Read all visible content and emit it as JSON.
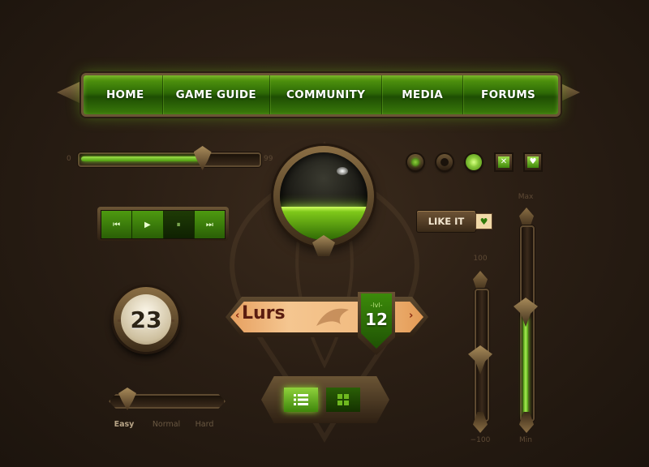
{
  "nav": {
    "items": [
      "HOME",
      "GAME GUIDE",
      "COMMUNITY",
      "MEDIA",
      "FORUMS"
    ]
  },
  "volume_slider": {
    "min_label": "0",
    "max_label": "99",
    "value_fraction": 0.7
  },
  "media_controls": {
    "prev_glyph": "⏮",
    "play_glyph": "▶",
    "pause_glyph": "⏸",
    "next_glyph": "⏭",
    "active": "pause"
  },
  "orb": {
    "fill_fraction": 0.38
  },
  "toggles": {
    "ring_states": [
      "on",
      "off",
      "lit"
    ],
    "close_glyph": "✕",
    "heart_glyph": "♥"
  },
  "like": {
    "label": "LIKE IT",
    "heart_glyph": "♥"
  },
  "counter": {
    "value": "23"
  },
  "character": {
    "name": "Lurs",
    "level_tag": "-lvl-",
    "level": "12",
    "prev_glyph": "‹",
    "next_glyph": "›"
  },
  "difficulty": {
    "options": [
      "Easy",
      "Normal",
      "Hard"
    ],
    "selected": "Easy"
  },
  "view_toggle": {
    "active": "list"
  },
  "vslider_left": {
    "max_label": "100",
    "min_label": "−100",
    "value_fraction": 0.45
  },
  "vslider_right": {
    "max_label": "Max",
    "min_label": "Min",
    "value_fraction": 0.55
  },
  "colors": {
    "accent_green": "#6fb81f",
    "bronze": "#8a6e44",
    "parchment": "#f5c690",
    "background": "#2a1e14"
  }
}
